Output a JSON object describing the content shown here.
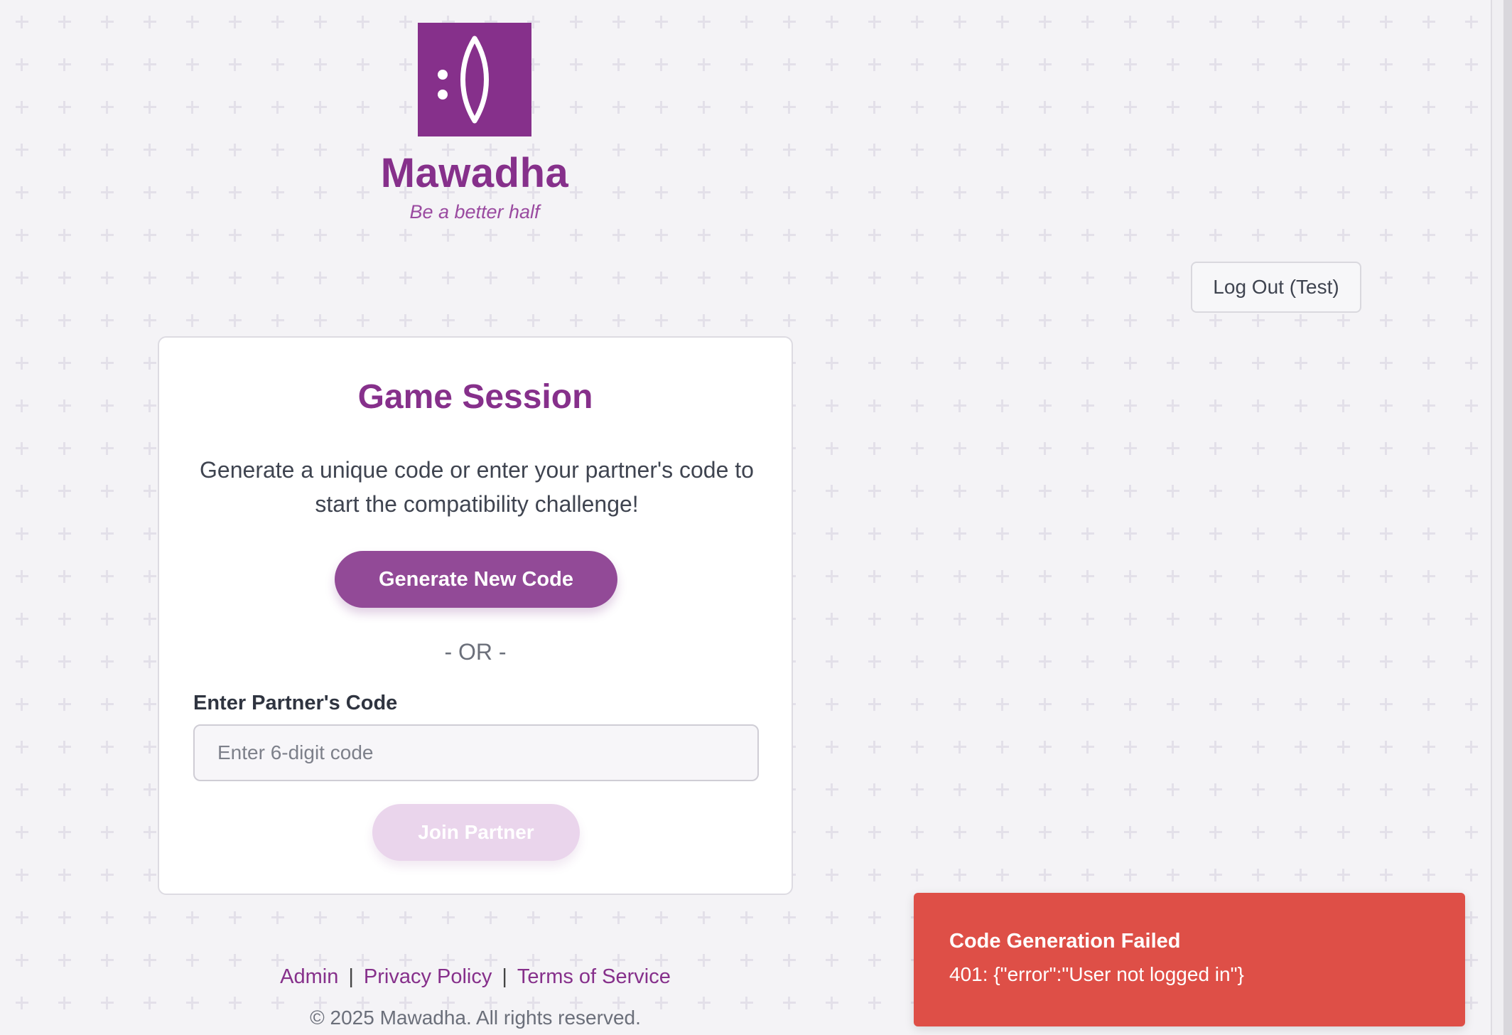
{
  "brand": {
    "name": "Mawadha",
    "tagline": "Be a better half",
    "logo_icon": "mawadha-logo-icon",
    "color": "#86308b"
  },
  "header": {
    "logout_label": "Log Out (Test)"
  },
  "session_card": {
    "title": "Game Session",
    "description": "Generate a unique code or enter your partner's code to start the compatibility challenge!",
    "generate_label": "Generate New Code",
    "or_text": "- OR -",
    "partner_code_label": "Enter Partner's Code",
    "partner_code_value": "",
    "partner_code_placeholder": "Enter 6-digit code",
    "join_label": "Join Partner"
  },
  "footer": {
    "links": [
      "Admin",
      "Privacy Policy",
      "Terms of Service"
    ],
    "separator": "|",
    "copyright": "© 2025 Mawadha. All rights reserved."
  },
  "toast": {
    "title": "Code Generation Failed",
    "message": "401: {\"error\":\"User not logged in\"}",
    "color": "#de4f47"
  }
}
